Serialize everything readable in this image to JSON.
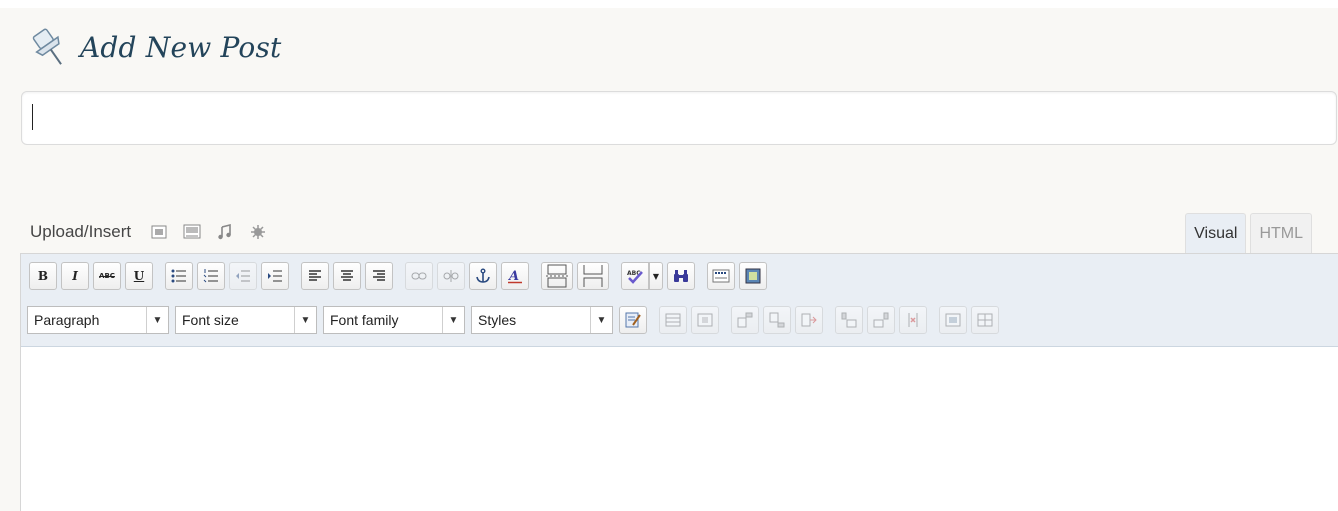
{
  "page": {
    "title": "Add New Post"
  },
  "title_field": {
    "value": "",
    "placeholder": ""
  },
  "media": {
    "label": "Upload/Insert",
    "icons": [
      "image-icon",
      "video-icon",
      "audio-icon",
      "media-icon"
    ]
  },
  "tabs": [
    {
      "label": "Visual",
      "active": true
    },
    {
      "label": "HTML",
      "active": false
    }
  ],
  "toolbar": {
    "row1": [
      "bold",
      "italic",
      "strikethrough",
      "underline",
      "bulleted-list",
      "numbered-list",
      "outdent",
      "indent",
      "align-left",
      "align-center",
      "align-right",
      "link",
      "unlink",
      "anchor",
      "text-color",
      "page-break",
      "more-break",
      "spellcheck",
      "spellcheck-dropdown",
      "find",
      "show-kitchen-sink",
      "insert-media"
    ],
    "row2": [
      "paste-word",
      "table",
      "cell",
      "insert-row-before",
      "insert-row-after",
      "delete-row",
      "insert-col-before",
      "insert-col-after",
      "delete-col",
      "merge-cells",
      "split-cells"
    ],
    "labels": {
      "bold": "B",
      "italic": "I",
      "strike": "ABC",
      "underline": "U"
    }
  },
  "selects": {
    "format": "Paragraph",
    "font_size": "Font size",
    "font_family": "Font family",
    "styles": "Styles"
  },
  "colors": {
    "accent": "#23445a",
    "toolbar_bg": "#e9eef4"
  }
}
